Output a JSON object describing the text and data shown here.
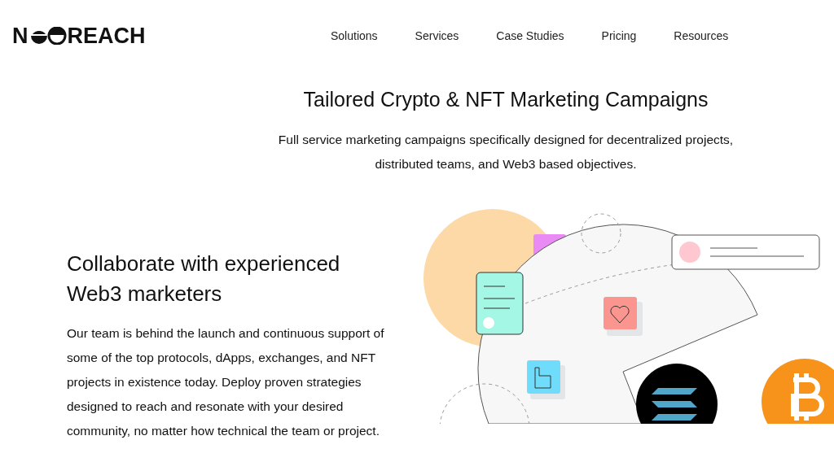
{
  "logo": {
    "start": "N",
    "end": "REACH"
  },
  "nav": [
    "Solutions",
    "Services",
    "Case Studies",
    "Pricing",
    "Resources"
  ],
  "hero": {
    "title": "Tailored Crypto & NFT Marketing Campaigns",
    "subtitle": "Full service marketing campaigns specifically designed for decentralized projects, distributed teams, and Web3 based objectives."
  },
  "section": {
    "heading": "Collaborate with experienced Web3 marketers",
    "body": "Our team is behind the launch and continuous support of some of the top protocols, dApps, exchanges, and NFT projects in existence today. Deploy proven strategies designed to reach and resonate with your desired community, no matter how technical the team or project."
  }
}
